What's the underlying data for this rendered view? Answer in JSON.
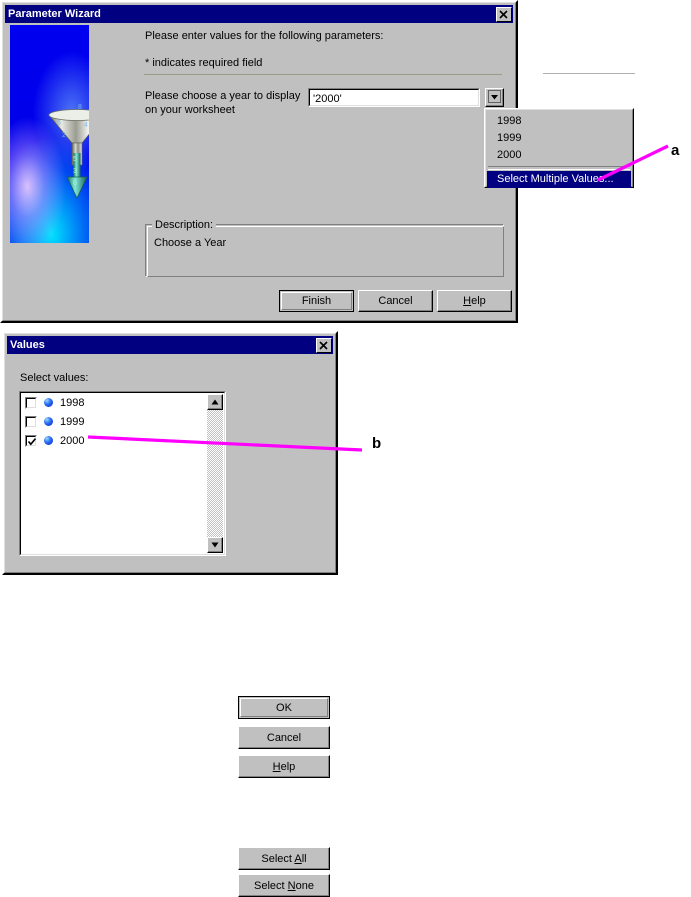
{
  "page": {
    "background": "#ffffff"
  },
  "wizard": {
    "title": "Parameter Wizard",
    "close_icon": "close-icon",
    "intro": "Please enter values for the following parameters:",
    "required_note": "* indicates required field",
    "prompt_line1": "Please choose a year to display",
    "prompt_line2": "on your worksheet",
    "year_value": "'2000'",
    "dropdown_button_icon": "chevron-down-icon",
    "dropdown": {
      "items": [
        "1998",
        "1999",
        "2000"
      ],
      "special_item": "Select Multiple Values...",
      "special_selected": true,
      "highlight_color": "#000080"
    },
    "description": {
      "legend": "Description:",
      "text": "Choose a Year"
    },
    "buttons": {
      "finish": "Finish",
      "cancel": "Cancel",
      "help": "Help",
      "help_accel": "H",
      "default": "Finish"
    },
    "artwork": "funnel-graphic"
  },
  "values_dialog": {
    "title": "Values",
    "close_icon": "close-icon",
    "list_label": "Select values:",
    "rows": [
      {
        "label": "1998",
        "checked": false
      },
      {
        "label": "1999",
        "checked": false
      },
      {
        "label": "2000",
        "checked": true
      }
    ],
    "scrollbar": {
      "up_icon": "scroll-up-arrow-icon",
      "down_icon": "scroll-down-arrow-icon"
    },
    "buttons": {
      "ok": "OK",
      "cancel": "Cancel",
      "help": "Help",
      "help_accel": "H",
      "select_all": "Select All",
      "select_all_accel": "A",
      "select_none": "Select None",
      "select_none_accel": "N",
      "default": "OK"
    }
  },
  "annotations": {
    "marker_a": "a",
    "marker_b": "b",
    "line_color": "#ff00ff"
  }
}
